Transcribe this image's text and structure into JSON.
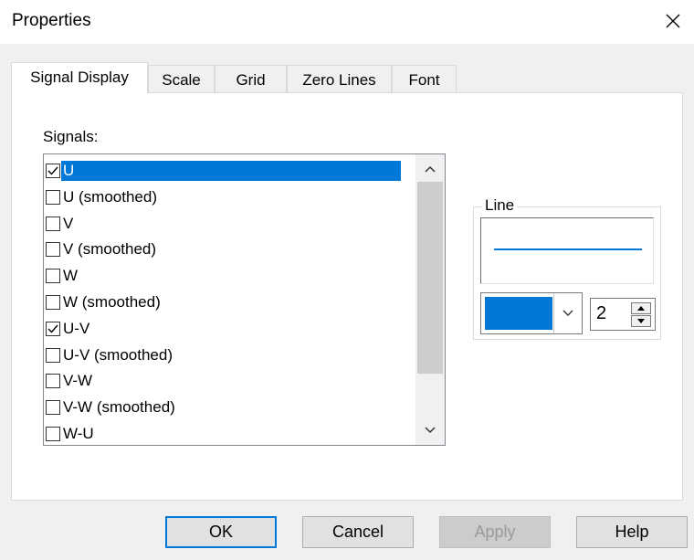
{
  "window": {
    "title": "Properties"
  },
  "tabs": [
    {
      "label": "Signal Display"
    },
    {
      "label": "Scale"
    },
    {
      "label": "Grid"
    },
    {
      "label": "Zero Lines"
    },
    {
      "label": "Font"
    }
  ],
  "signals": {
    "label": "Signals:",
    "items": [
      {
        "label": "U",
        "checked": true,
        "selected": true
      },
      {
        "label": "U (smoothed)",
        "checked": false
      },
      {
        "label": "V",
        "checked": false
      },
      {
        "label": "V (smoothed)",
        "checked": false
      },
      {
        "label": "W",
        "checked": false
      },
      {
        "label": "W (smoothed)",
        "checked": false
      },
      {
        "label": "U-V",
        "checked": true
      },
      {
        "label": "U-V (smoothed)",
        "checked": false
      },
      {
        "label": "V-W",
        "checked": false
      },
      {
        "label": "V-W (smoothed)",
        "checked": false
      },
      {
        "label": "W-U",
        "checked": false
      }
    ]
  },
  "line": {
    "title": "Line",
    "color": "#0078d7",
    "width": "2"
  },
  "buttons": {
    "ok": "OK",
    "cancel": "Cancel",
    "apply": "Apply",
    "help": "Help"
  },
  "colors": {
    "accent": "#0078d7",
    "selection": "#0078d7"
  }
}
